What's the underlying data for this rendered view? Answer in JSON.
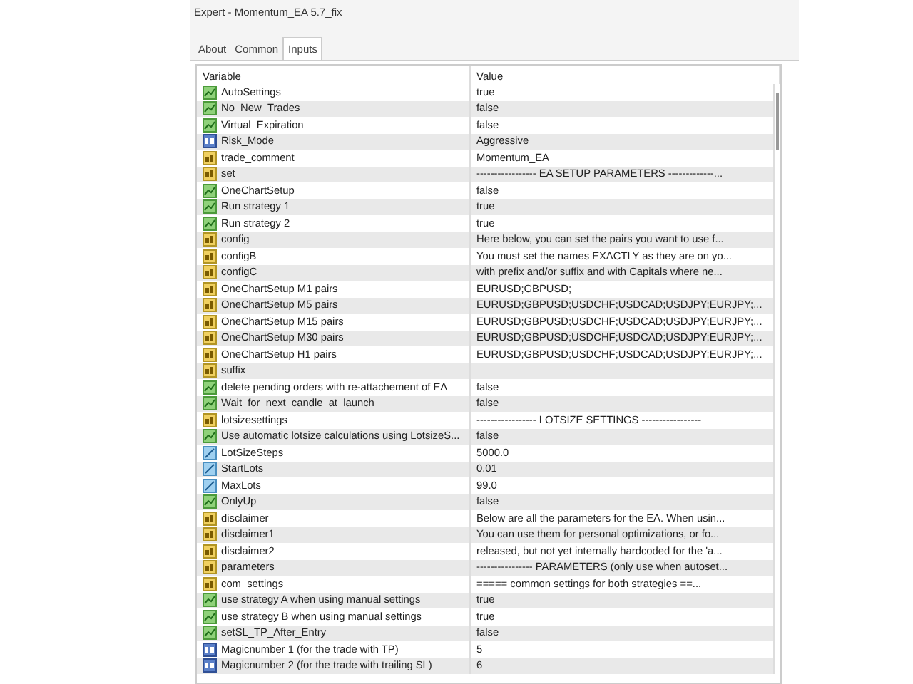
{
  "window": {
    "title": "Expert - Momentum_EA 5.7_fix"
  },
  "tabs": [
    {
      "label": "About",
      "selected": false
    },
    {
      "label": "Common",
      "selected": false
    },
    {
      "label": "Inputs",
      "selected": true
    }
  ],
  "table": {
    "columns": [
      "Variable",
      "Value"
    ],
    "rows": [
      {
        "kind": "bool",
        "variable": "AutoSettings",
        "value": "true"
      },
      {
        "kind": "bool",
        "variable": "No_New_Trades",
        "value": "false"
      },
      {
        "kind": "bool",
        "variable": "Virtual_Expiration",
        "value": "false"
      },
      {
        "kind": "enum",
        "variable": "Risk_Mode",
        "value": "Aggressive"
      },
      {
        "kind": "string",
        "variable": "trade_comment",
        "value": "Momentum_EA"
      },
      {
        "kind": "string",
        "variable": "set",
        "value": "----------------- EA SETUP PARAMETERS -------------..."
      },
      {
        "kind": "bool",
        "variable": "OneChartSetup",
        "value": "false"
      },
      {
        "kind": "bool",
        "variable": "Run strategy 1",
        "value": "true"
      },
      {
        "kind": "bool",
        "variable": "Run strategy 2",
        "value": "true"
      },
      {
        "kind": "string",
        "variable": "config",
        "value": "Here below, you can set the pairs you want to use f..."
      },
      {
        "kind": "string",
        "variable": "configB",
        "value": "You must set the names EXACTLY as they are on yo..."
      },
      {
        "kind": "string",
        "variable": "configC",
        "value": "with prefix and/or suffix and with Capitals where ne..."
      },
      {
        "kind": "string",
        "variable": "OneChartSetup M1 pairs",
        "value": "EURUSD;GBPUSD;"
      },
      {
        "kind": "string",
        "variable": "OneChartSetup M5 pairs",
        "value": "EURUSD;GBPUSD;USDCHF;USDCAD;USDJPY;EURJPY;..."
      },
      {
        "kind": "string",
        "variable": "OneChartSetup M15 pairs",
        "value": "EURUSD;GBPUSD;USDCHF;USDCAD;USDJPY;EURJPY;..."
      },
      {
        "kind": "string",
        "variable": "OneChartSetup M30 pairs",
        "value": "EURUSD;GBPUSD;USDCHF;USDCAD;USDJPY;EURJPY;..."
      },
      {
        "kind": "string",
        "variable": "OneChartSetup H1 pairs",
        "value": "EURUSD;GBPUSD;USDCHF;USDCAD;USDJPY;EURJPY;..."
      },
      {
        "kind": "string",
        "variable": "suffix"
      },
      {
        "kind": "bool",
        "variable": "delete pending orders with re-attachement of EA",
        "value": "false"
      },
      {
        "kind": "bool",
        "variable": "Wait_for_next_candle_at_launch",
        "value": "false"
      },
      {
        "kind": "string",
        "variable": "lotsizesettings",
        "value": "----------------- LOTSIZE SETTINGS -----------------"
      },
      {
        "kind": "bool",
        "variable": "Use automatic lotsize calculations using LotsizeS...",
        "value": "false"
      },
      {
        "kind": "double",
        "variable": "LotSizeSteps",
        "value": "5000.0"
      },
      {
        "kind": "double",
        "variable": "StartLots",
        "value": "0.01"
      },
      {
        "kind": "double",
        "variable": "MaxLots",
        "value": "99.0"
      },
      {
        "kind": "bool",
        "variable": "OnlyUp",
        "value": "false"
      },
      {
        "kind": "string",
        "variable": "disclaimer",
        "value": "Below are all the parameters for the EA.  When usin..."
      },
      {
        "kind": "string",
        "variable": "disclaimer1",
        "value": "You can use them for personal optimizations, or fo..."
      },
      {
        "kind": "string",
        "variable": "disclaimer2",
        "value": "released, but not yet internally hardcoded for the 'a..."
      },
      {
        "kind": "string",
        "variable": "parameters",
        "value": "---------------- PARAMETERS (only use when autoset..."
      },
      {
        "kind": "string",
        "variable": "com_settings",
        "value": "===== common settings for both strategies ==..."
      },
      {
        "kind": "bool",
        "variable": "use strategy A when using manual settings",
        "value": "true"
      },
      {
        "kind": "bool",
        "variable": "use strategy B when using manual settings",
        "value": "true"
      },
      {
        "kind": "bool",
        "variable": "setSL_TP_After_Entry",
        "value": "false"
      },
      {
        "kind": "int",
        "variable": "Magicnumber 1 (for the trade with TP)",
        "value": "5"
      },
      {
        "kind": "int",
        "variable": "Magicnumber 2 (for the trade with trailing SL)",
        "value": "6"
      }
    ]
  }
}
